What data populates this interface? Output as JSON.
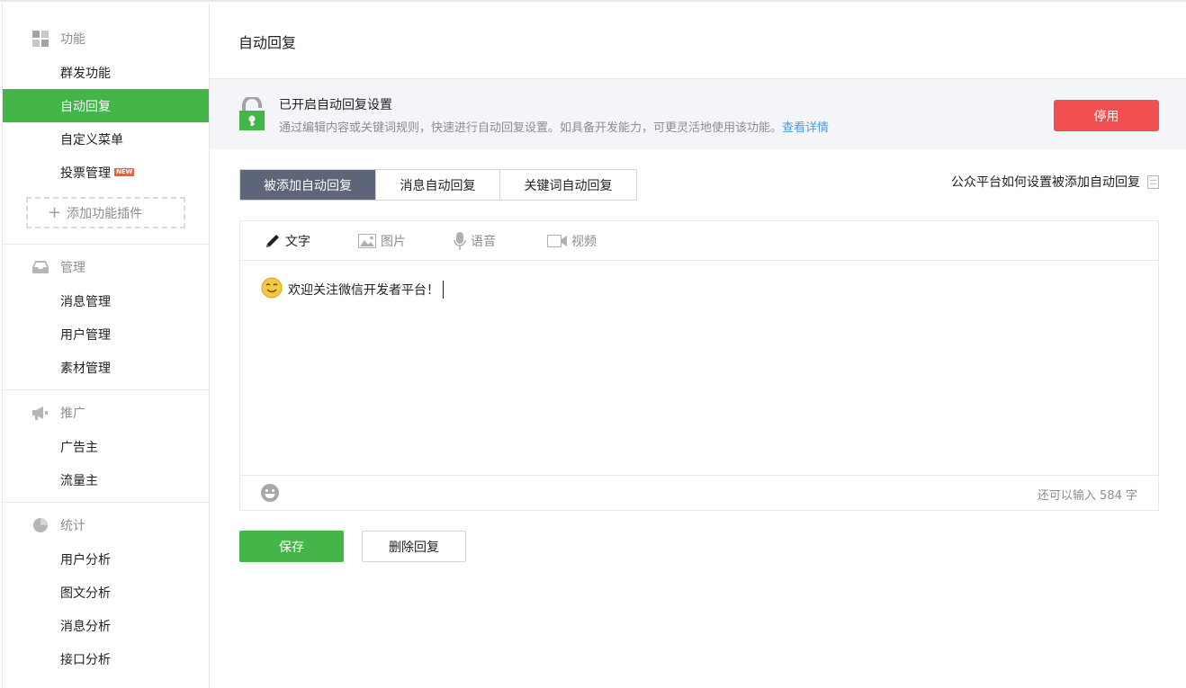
{
  "sidebar": {
    "sections": [
      {
        "title": "功能",
        "icon": "grid-icon",
        "items": [
          {
            "label": "群发功能"
          },
          {
            "label": "自动回复",
            "active": true
          },
          {
            "label": "自定义菜单"
          },
          {
            "label": "投票管理",
            "badge": "NEW"
          }
        ],
        "add_plugin": "添加功能插件"
      },
      {
        "title": "管理",
        "icon": "inbox-icon",
        "items": [
          {
            "label": "消息管理"
          },
          {
            "label": "用户管理"
          },
          {
            "label": "素材管理"
          }
        ]
      },
      {
        "title": "推广",
        "icon": "megaphone-icon",
        "items": [
          {
            "label": "广告主"
          },
          {
            "label": "流量主"
          }
        ]
      },
      {
        "title": "统计",
        "icon": "pie-chart-icon",
        "items": [
          {
            "label": "用户分析"
          },
          {
            "label": "图文分析"
          },
          {
            "label": "消息分析"
          },
          {
            "label": "接口分析"
          }
        ]
      }
    ]
  },
  "main": {
    "title": "自动回复",
    "notice": {
      "title": "已开启自动回复设置",
      "desc": "通过编辑内容或关键词规则，快速进行自动回复设置。如具备开发能力，可更灵活地使用该功能。",
      "link": "查看详情",
      "disable_button": "停用"
    },
    "tabs": [
      "被添加自动回复",
      "消息自动回复",
      "关键词自动回复"
    ],
    "help_link": "公众平台如何设置被添加自动回复",
    "editor": {
      "types": [
        "文字",
        "图片",
        "语音",
        "视频"
      ],
      "content": "欢迎关注微信开发者平台！",
      "counter": "还可以输入 584 字"
    },
    "save_button": "保存",
    "delete_button": "删除回复"
  },
  "colors": {
    "accent": "#44b549",
    "danger": "#f05051",
    "tab_active": "#5c6678",
    "link": "#459ae9"
  }
}
